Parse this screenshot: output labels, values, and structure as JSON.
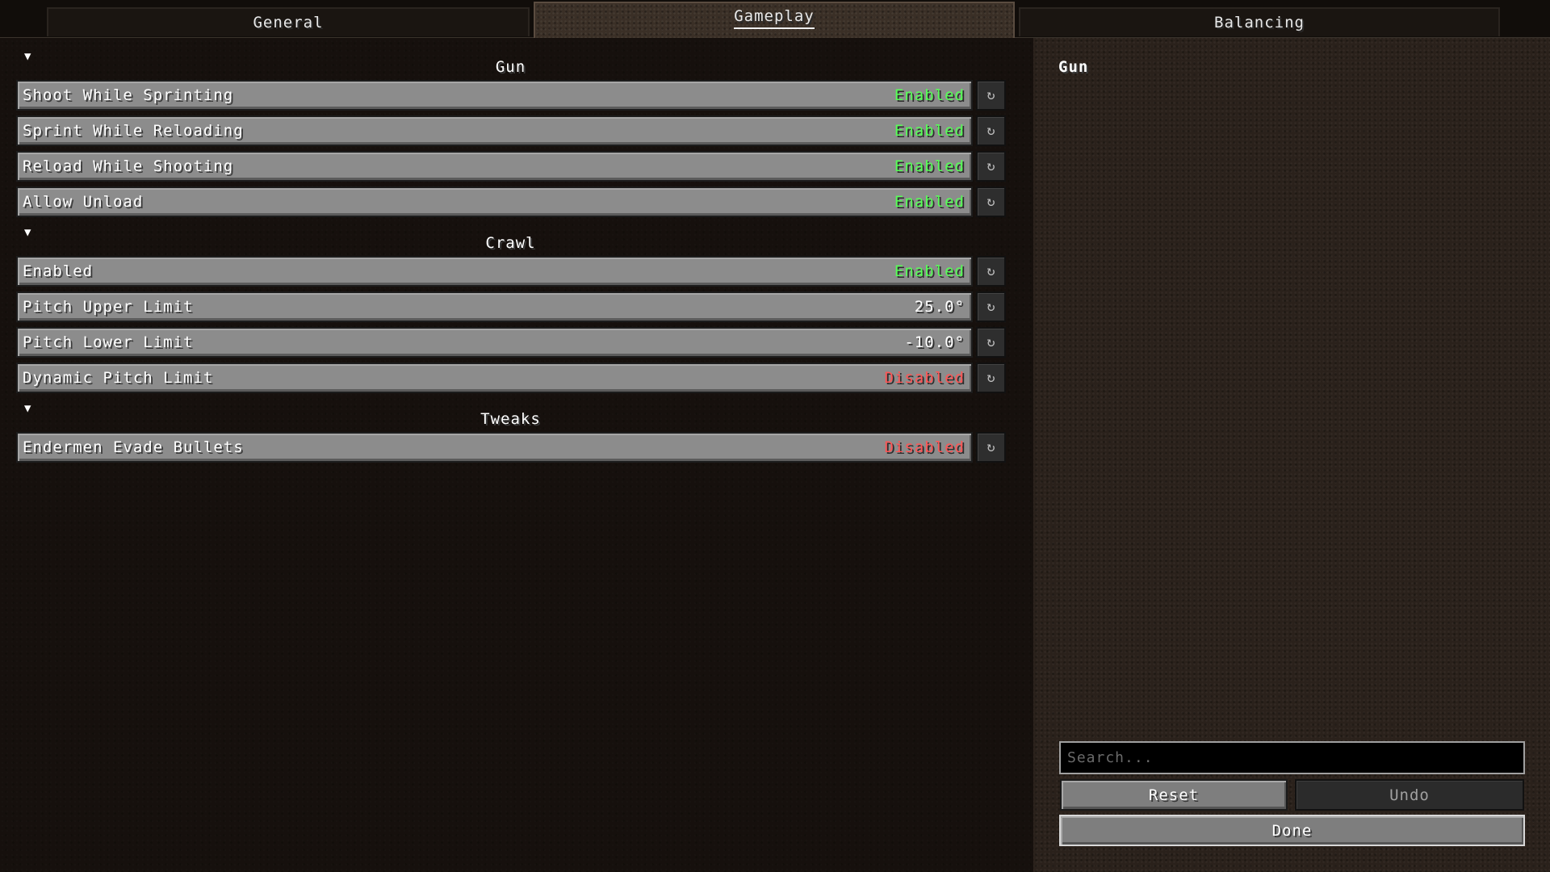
{
  "tabs": [
    {
      "label": "General",
      "active": false
    },
    {
      "label": "Gameplay",
      "active": true
    },
    {
      "label": "Balancing",
      "active": false
    }
  ],
  "sections": [
    {
      "title": "Gun",
      "collapse_icon": "triangle-down-icon",
      "options": [
        {
          "name": "Shoot While Sprinting",
          "value": "Enabled",
          "state": "enabled"
        },
        {
          "name": "Sprint While Reloading",
          "value": "Enabled",
          "state": "enabled"
        },
        {
          "name": "Reload While Shooting",
          "value": "Enabled",
          "state": "enabled"
        },
        {
          "name": "Allow Unload",
          "value": "Enabled",
          "state": "enabled"
        }
      ]
    },
    {
      "title": "Crawl",
      "collapse_icon": "triangle-down-icon",
      "options": [
        {
          "name": "Enabled",
          "value": "Enabled",
          "state": "enabled"
        },
        {
          "name": "Pitch Upper Limit",
          "value": "25.0°",
          "state": "number"
        },
        {
          "name": "Pitch Lower Limit",
          "value": "-10.0°",
          "state": "number"
        },
        {
          "name": "Dynamic Pitch Limit",
          "value": "Disabled",
          "state": "disabled"
        }
      ]
    },
    {
      "title": "Tweaks",
      "collapse_icon": "triangle-down-icon",
      "options": [
        {
          "name": "Endermen Evade Bullets",
          "value": "Disabled",
          "state": "disabled"
        }
      ]
    }
  ],
  "row_reset_icon": "reset-arrow-icon",
  "info": {
    "title": "Gun"
  },
  "search": {
    "placeholder": "Search...",
    "value": ""
  },
  "buttons": {
    "reset_label": "Reset",
    "undo_label": "Undo",
    "done_label": "Done"
  },
  "colors": {
    "enabled": "#55ff55",
    "disabled": "#ff5555",
    "value_text": "#ffffff"
  }
}
